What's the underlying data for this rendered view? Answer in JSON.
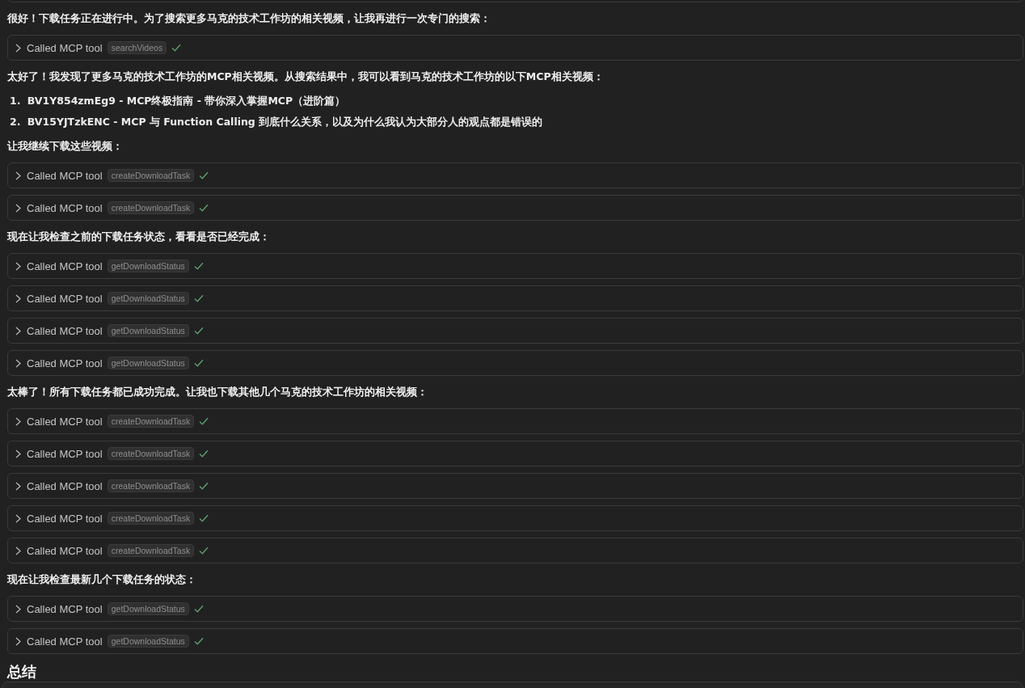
{
  "messages": [
    {
      "kind": "text",
      "text": "很好！下载任务正在进行中。为了搜索更多马克的技术工作坊的相关视频，让我再进行一次专门的搜索："
    },
    {
      "kind": "tool",
      "label": "Called MCP tool",
      "tool": "searchVideos",
      "succeeded": true
    },
    {
      "kind": "text",
      "text": "太好了！我发现了更多马克的技术工作坊的MCP相关视频。从搜索结果中，我可以看到马克的技术工作坊的以下MCP相关视频："
    },
    {
      "kind": "list_item",
      "number": "1.",
      "text": "BV1Y854zmEg9 - MCP终极指南 - 带你深入掌握MCP（进阶篇）"
    },
    {
      "kind": "list_item",
      "number": "2.",
      "text": "BV15YJTzkENC - MCP 与 Function Calling 到底什么关系，以及为什么我认为大部分人的观点都是错误的"
    },
    {
      "kind": "text",
      "text": "让我继续下载这些视频："
    },
    {
      "kind": "tool",
      "label": "Called MCP tool",
      "tool": "createDownloadTask",
      "succeeded": true
    },
    {
      "kind": "tool",
      "label": "Called MCP tool",
      "tool": "createDownloadTask",
      "succeeded": true
    },
    {
      "kind": "text",
      "text": "现在让我检查之前的下载任务状态，看看是否已经完成："
    },
    {
      "kind": "tool",
      "label": "Called MCP tool",
      "tool": "getDownloadStatus",
      "succeeded": true
    },
    {
      "kind": "tool",
      "label": "Called MCP tool",
      "tool": "getDownloadStatus",
      "succeeded": true
    },
    {
      "kind": "tool",
      "label": "Called MCP tool",
      "tool": "getDownloadStatus",
      "succeeded": true
    },
    {
      "kind": "tool",
      "label": "Called MCP tool",
      "tool": "getDownloadStatus",
      "succeeded": true
    },
    {
      "kind": "text",
      "text": "太棒了！所有下载任务都已成功完成。让我也下载其他几个马克的技术工作坊的相关视频："
    },
    {
      "kind": "tool",
      "label": "Called MCP tool",
      "tool": "createDownloadTask",
      "succeeded": true
    },
    {
      "kind": "tool",
      "label": "Called MCP tool",
      "tool": "createDownloadTask",
      "succeeded": true
    },
    {
      "kind": "tool",
      "label": "Called MCP tool",
      "tool": "createDownloadTask",
      "succeeded": true
    },
    {
      "kind": "tool",
      "label": "Called MCP tool",
      "tool": "createDownloadTask",
      "succeeded": true
    },
    {
      "kind": "tool",
      "label": "Called MCP tool",
      "tool": "createDownloadTask",
      "succeeded": true
    },
    {
      "kind": "text",
      "text": "现在让我检查最新几个下载任务的状态："
    },
    {
      "kind": "tool",
      "label": "Called MCP tool",
      "tool": "getDownloadStatus",
      "succeeded": true
    },
    {
      "kind": "tool",
      "label": "Called MCP tool",
      "tool": "getDownloadStatus",
      "succeeded": true
    },
    {
      "kind": "heading",
      "text": "总结"
    }
  ]
}
